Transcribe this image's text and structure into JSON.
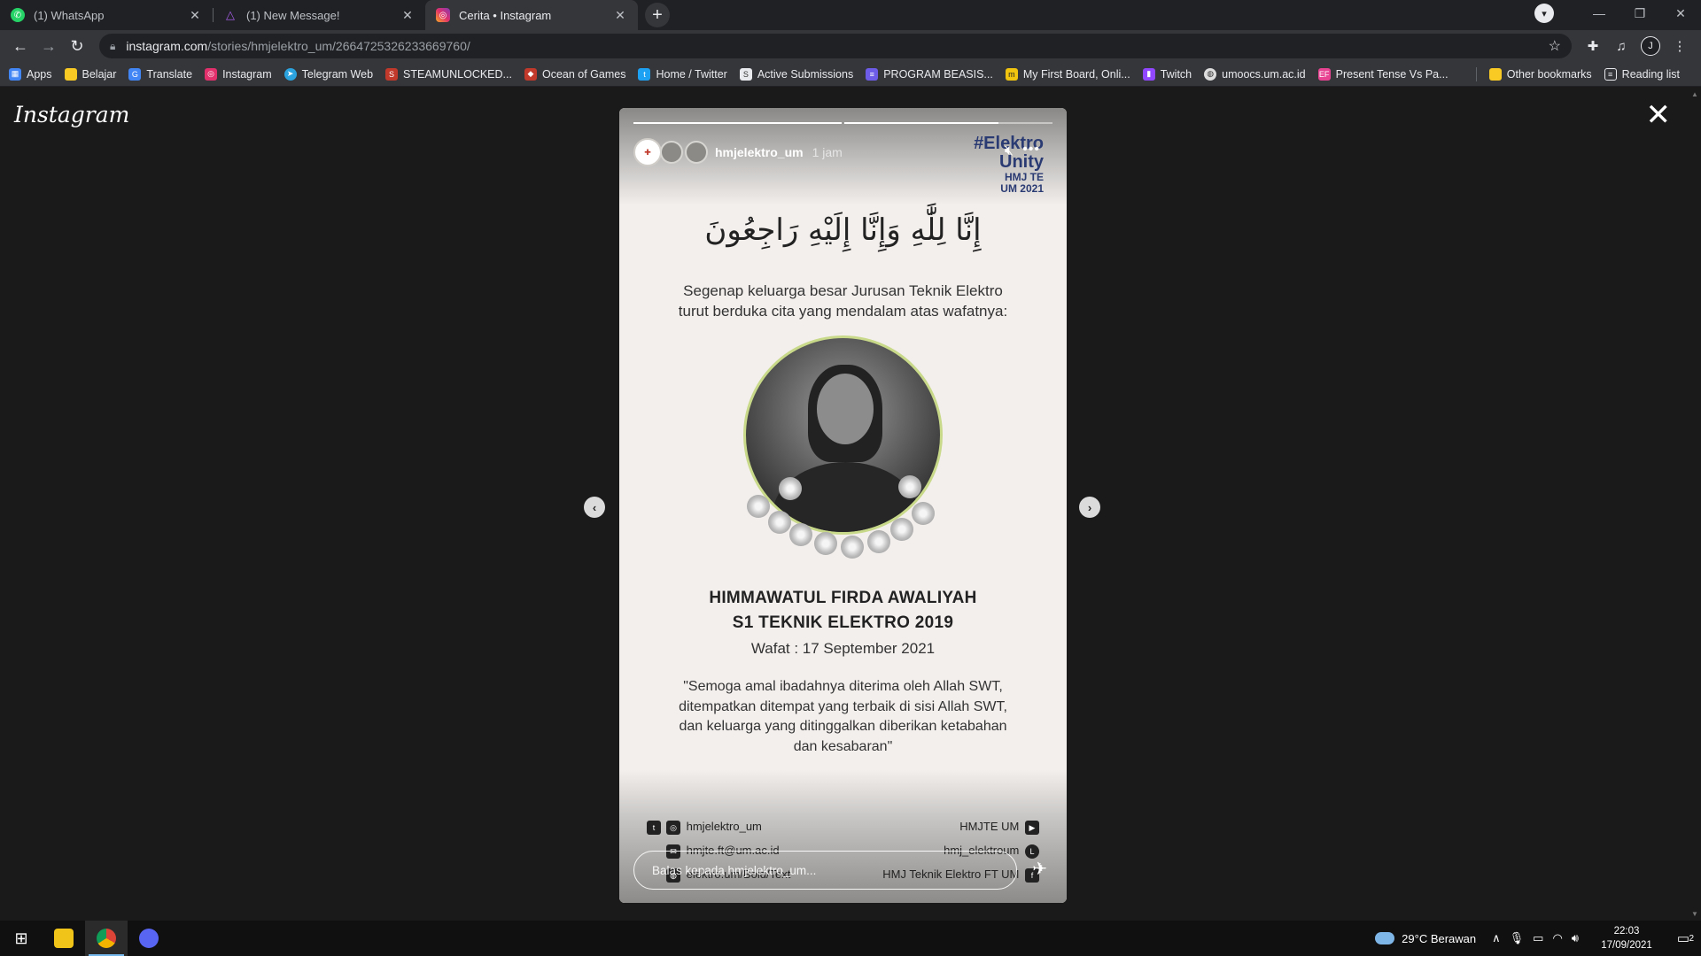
{
  "tabs": [
    {
      "title": "(1) WhatsApp",
      "icon": "whatsapp-icon",
      "color": "#25d366",
      "active": false
    },
    {
      "title": "(1) New Message!",
      "icon": "triangle-logo-icon",
      "color": "#8e44ad",
      "active": false
    },
    {
      "title": "Cerita • Instagram",
      "icon": "instagram-icon",
      "color": "#e1306c",
      "active": true
    }
  ],
  "address": {
    "host": "instagram.com",
    "path": "/stories/hmjelektro_um/2664725326233669760/"
  },
  "bookmarks": [
    {
      "label": "Apps",
      "icon": "apps-grid-icon",
      "color": "#4285f4"
    },
    {
      "label": "Belajar",
      "icon": "folder-icon",
      "color": "#f9ca24"
    },
    {
      "label": "Translate",
      "icon": "translate-icon",
      "color": "#4285f4"
    },
    {
      "label": "Instagram",
      "icon": "instagram-icon",
      "color": "#e1306c"
    },
    {
      "label": "Telegram Web",
      "icon": "telegram-icon",
      "color": "#2aa3df"
    },
    {
      "label": "STEAMUNLOCKED...",
      "icon": "steamunlocked-icon",
      "color": "#c0392b"
    },
    {
      "label": "Ocean of Games",
      "icon": "ocean-of-games-icon",
      "color": "#c0392b"
    },
    {
      "label": "Home / Twitter",
      "icon": "twitter-icon",
      "color": "#1da1f2"
    },
    {
      "label": "Active Submissions",
      "icon": "submissions-icon",
      "color": "#555555"
    },
    {
      "label": "PROGRAM BEASIS...",
      "icon": "list-icon",
      "color": "#6c5ce7"
    },
    {
      "label": "My First Board, Onli...",
      "icon": "board-icon",
      "color": "#f1c40f"
    },
    {
      "label": "Twitch",
      "icon": "twitch-icon",
      "color": "#9146ff"
    },
    {
      "label": "umoocs.um.ac.id",
      "icon": "globe-icon",
      "color": "#dddddd"
    },
    {
      "label": "Present Tense Vs Pa...",
      "icon": "ef-icon",
      "color": "#e84393"
    }
  ],
  "bookmarks_right": [
    {
      "label": "Other bookmarks",
      "icon": "folder-icon",
      "color": "#f9ca24"
    },
    {
      "label": "Reading list",
      "icon": "reading-list-icon",
      "color": "#e8eaed"
    }
  ],
  "page": {
    "logo_text": "Instagram",
    "close_symbol": "✕"
  },
  "story": {
    "username": "hmjelektro_um",
    "time_ago": "1 jam",
    "hashtag_line1": "#Elektro",
    "hashtag_line2": "Unity",
    "hashtag_badge_1": "HMJ TE",
    "hashtag_badge_2": "UM 2021",
    "progress_current": 0.74,
    "arabic_text": "إِنَّا لِلَّٰهِ وَإِنَّا إِلَيْهِ رَاجِعُونَ",
    "condolence_line1": "Segenap keluarga besar Jurusan Teknik Elektro",
    "condolence_line2": "turut berduka cita yang mendalam atas wafatnya:",
    "name_line1": "HIMMAWATUL FIRDA AWALIYAH",
    "name_line2": "S1 TEKNIK ELEKTRO 2019",
    "wafat": "Wafat : 17 September 2021",
    "quote_line1": "\"Semoga amal ibadahnya diterima oleh Allah SWT,",
    "quote_line2": "ditempatkan ditempat yang terbaik di sisi Allah SWT,",
    "quote_line3": "dan keluarga yang ditinggalkan diberikan ketabahan",
    "quote_line4": "dan kesabaran\"",
    "footer_left_1": "hmjelektro_um",
    "footer_left_2": "hmjte.ft@um.ac.id",
    "footer_left_3": "elektro.um/Bold/Text",
    "footer_right_1": "HMJTE UM",
    "footer_right_2": "hmj_elektroum",
    "footer_right_3": "HMJ Teknik Elektro FT UM",
    "reply_placeholder": "Balas kepada hmjelektro_um..."
  },
  "taskbar": {
    "apps": [
      {
        "name": "file-explorer-icon",
        "color": "#f0c419",
        "active": false
      },
      {
        "name": "chrome-icon",
        "color": "#db4437",
        "active": true
      },
      {
        "name": "discord-icon",
        "color": "#5865f2",
        "active": false
      }
    ],
    "weather": "29°C  Berawan",
    "time": "22:03",
    "date": "17/09/2021",
    "notification_count": "2"
  }
}
